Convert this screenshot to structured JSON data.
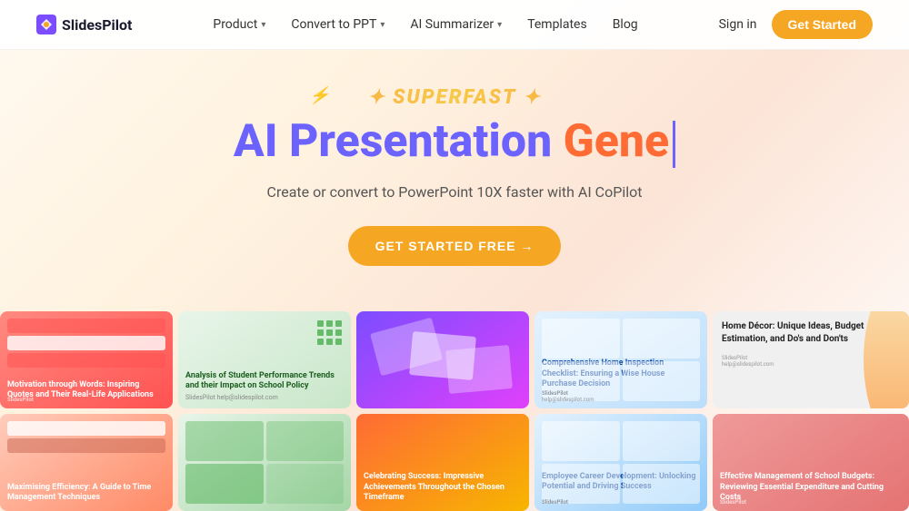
{
  "brand": {
    "name": "SlidesPilot",
    "logo_emoji": "🎯"
  },
  "nav": {
    "links": [
      {
        "label": "Product",
        "has_dropdown": true
      },
      {
        "label": "Convert to PPT",
        "has_dropdown": true
      },
      {
        "label": "AI Summarizer",
        "has_dropdown": true
      },
      {
        "label": "Templates",
        "has_dropdown": false
      },
      {
        "label": "Blog",
        "has_dropdown": false
      }
    ],
    "sign_in": "Sign in",
    "get_started": "Get Started"
  },
  "hero": {
    "superfast": "✦ SUPERFAST ✦",
    "title_part1": "AI Presentation Gene",
    "subtitle": "Create or convert to PowerPoint 10X faster with AI CoPilot",
    "cta": "GET STARTED FREE →"
  },
  "gallery": {
    "row1": [
      {
        "title": "Motivation through Words: Inspiring Quotes and Their Real-Life Applications",
        "bg": "pink",
        "type": "slides"
      },
      {
        "title": "Analysis of Student Performance Trends and their Impact on School Policy",
        "bg": "green",
        "type": "text",
        "subtitle": "SlidesPilot\nhelp@slidespilot.com"
      },
      {
        "title": "",
        "bg": "purple",
        "type": "scattered"
      },
      {
        "title": "Comprehensive Home Inspection Checklist: Ensuring a Wise House Purchase Decision",
        "bg": "lightblue",
        "type": "text",
        "subtitle": "SlidesPilot\nhelp@slidespilot.com"
      },
      {
        "title": "Home Décor: Unique Ideas, Budget Estimation, and Do's and Don'ts",
        "bg": "grey",
        "type": "text",
        "meta": "SlidesPilot\nhelp@slidespilot.com"
      }
    ],
    "row2": [
      {
        "title": "Maximising Efficiency: A Guide to Time Management Techniques",
        "bg": "salmon",
        "type": "slides"
      },
      {
        "title": "",
        "bg": "lightgreen",
        "type": "grid"
      },
      {
        "title": "Celebrating Success: Impressive Achievements Throughout the Chosen Timeframe",
        "bg": "orange",
        "type": "text"
      },
      {
        "title": "Employee Career Development: Unlocking Potential and Driving Success",
        "bg": "lightblue2",
        "type": "text",
        "subtitle": "SlidesPilot\nhelp@slidespilot.com"
      },
      {
        "title": "Effective Management of School Budgets: Reviewing Essential Expenditure and Cutting Costs",
        "bg": "red",
        "type": "text"
      }
    ]
  }
}
